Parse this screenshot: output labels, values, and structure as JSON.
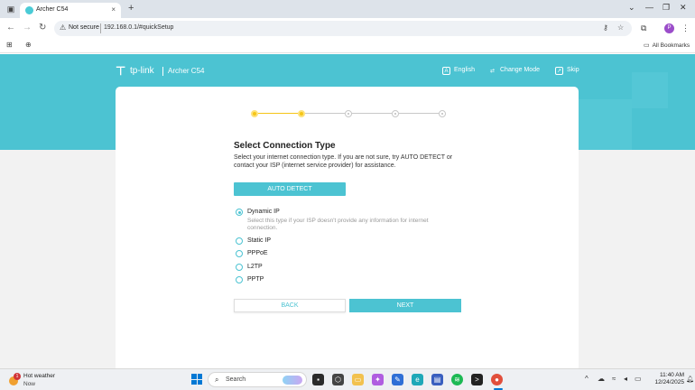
{
  "browser": {
    "tab_title": "Archer C54",
    "tab_close": "×",
    "new_tab": "+",
    "window_controls": [
      "⌄",
      "—",
      "❐",
      "✕"
    ],
    "security_label": "Not secure",
    "url": "192.168.0.1/#quickSetup",
    "bookmarks_label": "All Bookmarks",
    "profile_initial": "P"
  },
  "header": {
    "brand": "tp-link",
    "model": "Archer C54",
    "actions": {
      "language": "English",
      "change_mode": "Change Mode",
      "skip": "Skip"
    }
  },
  "wizard": {
    "steps_total": 5,
    "steps_completed": 2,
    "title": "Select Connection Type",
    "description": "Select your internet connection type. If you are not sure, try AUTO DETECT or contact your ISP (internet service provider) for assistance.",
    "auto_detect": "AUTO DETECT",
    "options": [
      {
        "label": "Dynamic IP",
        "selected": true
      },
      {
        "label": "Static IP",
        "selected": false
      },
      {
        "label": "PPPoE",
        "selected": false
      },
      {
        "label": "L2TP",
        "selected": false
      },
      {
        "label": "PPTP",
        "selected": false
      }
    ],
    "dynamic_hint": "Select this type if your ISP doesn't provide any information for internet connection.",
    "back": "BACK",
    "next": "NEXT"
  },
  "taskbar": {
    "weather_title": "Hot weather",
    "weather_sub": "Now",
    "weather_badge": "1",
    "search_placeholder": "Search",
    "time": "11:40 AM",
    "date": "12/24/2025"
  },
  "colors": {
    "accent": "#4cc3d2",
    "step_done": "#f5c518"
  }
}
